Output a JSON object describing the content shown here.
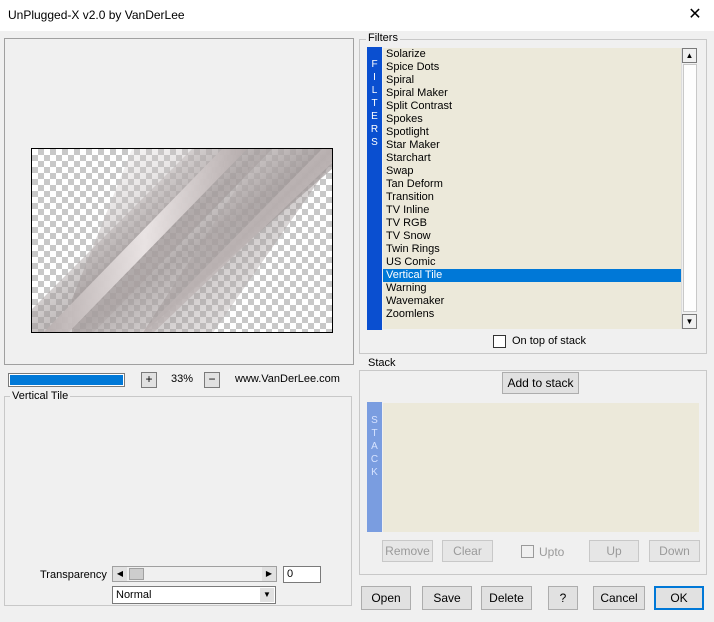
{
  "window": {
    "title": "UnPlugged-X v2.0 by VanDerLee",
    "close_glyph": "✕"
  },
  "preview": {
    "zoom_percent": "33%",
    "zoom_in_label": "+",
    "zoom_out_label": "−",
    "website": "www.VanDerLee.com",
    "progress_fraction": 1.0
  },
  "settings": {
    "group_title": "Vertical Tile",
    "transparency_label": "Transparency",
    "transparency_value": "0",
    "transparency_fraction": 0.0,
    "blend_mode": "Normal"
  },
  "filters": {
    "group_title": "Filters",
    "strip_label": "F I L T E R S",
    "items": [
      "Solarize",
      "Spice Dots",
      "Spiral",
      "Spiral Maker",
      "Split Contrast",
      "Spokes",
      "Spotlight",
      "Star Maker",
      "Starchart",
      "Swap",
      "Tan Deform",
      "Transition",
      "TV Inline",
      "TV RGB",
      "TV Snow",
      "Twin Rings",
      "US Comic",
      "Vertical Tile",
      "Warning",
      "Wavemaker",
      "Zoomlens"
    ],
    "selected": "Vertical Tile",
    "on_top_label": "On top of stack",
    "on_top_checked": false
  },
  "stack": {
    "group_title": "Stack",
    "add_label": "Add to stack",
    "strip_label": "S T A C K",
    "remove_label": "Remove",
    "clear_label": "Clear",
    "upto_label": "Upto",
    "up_label": "Up",
    "down_label": "Down"
  },
  "buttons": {
    "open": "Open",
    "save": "Save",
    "delete": "Delete",
    "help": "?",
    "cancel": "Cancel",
    "ok": "OK"
  },
  "colors": {
    "accent": "#0078d7",
    "filter_strip": "#0a4fd0",
    "stack_strip": "#7a9de0",
    "list_bg": "#ece9da"
  }
}
